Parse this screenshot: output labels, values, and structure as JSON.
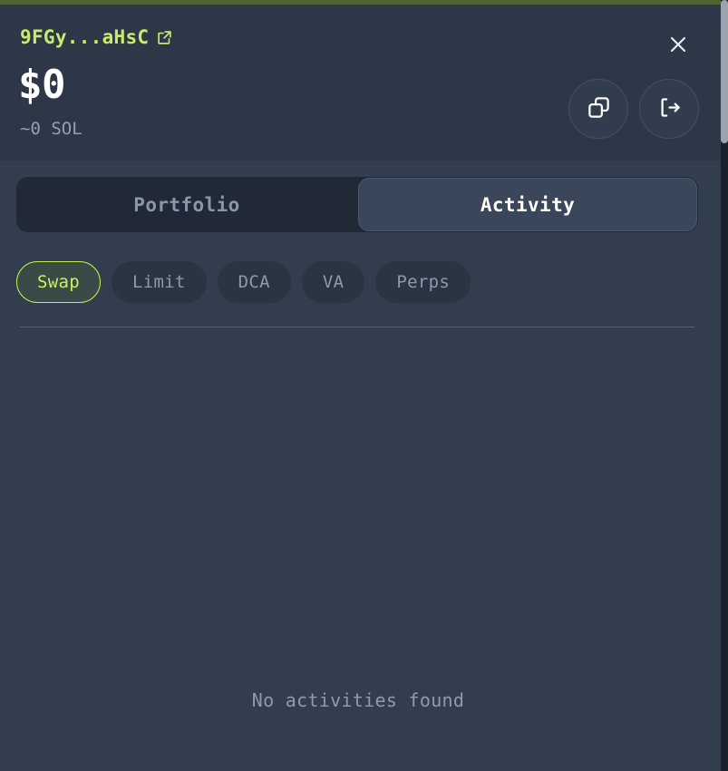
{
  "theme": {
    "background": "#323d4e",
    "header_background": "#2d3748",
    "accent_green": "#c3f04a",
    "accent_bar": "#4f6430",
    "text_primary": "#ffffff",
    "text_muted": "#8e9bae",
    "tabs_background": "#212836",
    "tab_active_background": "#3a465a",
    "chip_background": "#2b3443",
    "chip_active_background": "#3a4a46",
    "divider": "#56637a",
    "scrollbar_thumb": "#9aa3ae"
  },
  "header": {
    "wallet_address": "9FGy...aHsC",
    "external_link_icon": "external-link-icon",
    "balance_fiat": "$0",
    "balance_native": "~0 SOL",
    "close_icon": "close-icon",
    "actions": [
      {
        "name": "copy-address-button",
        "icon": "copy-icon"
      },
      {
        "name": "disconnect-wallet-button",
        "icon": "logout-icon"
      }
    ]
  },
  "tabs": [
    {
      "label": "Portfolio",
      "active": false
    },
    {
      "label": "Activity",
      "active": true
    }
  ],
  "filters": [
    {
      "label": "Swap",
      "active": true
    },
    {
      "label": "Limit",
      "active": false
    },
    {
      "label": "DCA",
      "active": false
    },
    {
      "label": "VA",
      "active": false
    },
    {
      "label": "Perps",
      "active": false
    }
  ],
  "content": {
    "empty_message": "No activities found"
  }
}
